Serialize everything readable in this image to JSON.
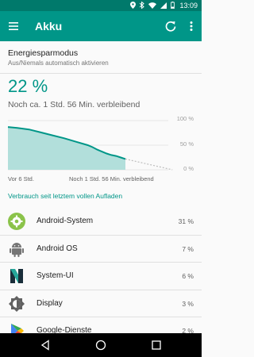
{
  "status_bar": {
    "time": "13:09"
  },
  "app_bar": {
    "title": "Akku"
  },
  "battery_saver": {
    "title": "Energiesparmodus",
    "subtitle": "Aus/Niemals automatisch aktivieren"
  },
  "level": {
    "percent_text": "22 %",
    "remaining_text": "Noch ca. 1 Std. 56 Min. verbleibend"
  },
  "chart_data": {
    "type": "line",
    "x_labels": [
      "Vor 6 Std.",
      "Noch 1 Std. 56 Min. verbleibend"
    ],
    "y_labels": [
      "100 %",
      "50 %",
      "0 %"
    ],
    "ylim": [
      0,
      100
    ],
    "history": [
      [
        0,
        87
      ],
      [
        8,
        85
      ],
      [
        18,
        82
      ],
      [
        28,
        76
      ],
      [
        38,
        70
      ],
      [
        48,
        64
      ],
      [
        58,
        57
      ],
      [
        68,
        50
      ],
      [
        72,
        46
      ],
      [
        76,
        41
      ],
      [
        80,
        37
      ],
      [
        84,
        33
      ],
      [
        88,
        30
      ],
      [
        92,
        28
      ],
      [
        96,
        25
      ],
      [
        100,
        22
      ]
    ],
    "projection": [
      [
        100,
        22
      ],
      [
        140,
        0
      ]
    ],
    "colors": {
      "line": "#009688",
      "fill": "#b2dfdb",
      "projection": "#bdbdbd"
    }
  },
  "usage_header": "Verbrauch seit letztem vollen Aufladen",
  "usage": [
    {
      "name": "Android-System",
      "value": "31 %",
      "icon": "gear-icon"
    },
    {
      "name": "Android OS",
      "value": "7 %",
      "icon": "android-icon"
    },
    {
      "name": "System-UI",
      "value": "6 %",
      "icon": "n-logo-icon"
    },
    {
      "name": "Display",
      "value": "3 %",
      "icon": "brightness-icon"
    },
    {
      "name": "Google-Dienste",
      "value": "2 %",
      "icon": "play-icon"
    }
  ]
}
